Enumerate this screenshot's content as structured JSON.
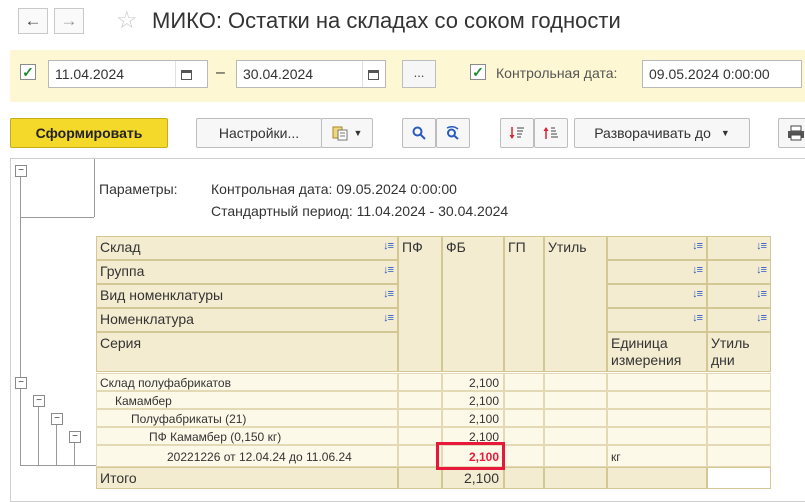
{
  "window": {
    "title": "МИКО: Остатки на складах со соком годности"
  },
  "nav": {
    "back_icon": "←",
    "forward_icon": "→",
    "star_icon": "☆"
  },
  "period": {
    "start_date": "11.04.2024",
    "end_date": "30.04.2024",
    "dash": "–",
    "dots_label": "...",
    "control_label": "Контрольная дата:",
    "control_value": "09.05.2024  0:00:00"
  },
  "toolbar": {
    "generate_label": "Сформировать",
    "settings_label": "Настройки...",
    "expand_label": "Разворачивать до"
  },
  "report": {
    "params_label": "Параметры:",
    "param1": "Контрольная дата: 09.05.2024 0:00:00",
    "param2": "Стандартный период: 11.04.2024 - 30.04.2024",
    "headers": {
      "sklad": "Склад",
      "gruppa": "Группа",
      "vid": "Вид номенклатуры",
      "nomenklatura": "Номенклатура",
      "seriya": "Серия",
      "pf": "ПФ",
      "fb": "ФБ",
      "gp": "ГП",
      "util": "Утиль",
      "unit": "Единица измерения",
      "util_days": "Утиль дни"
    },
    "rows": [
      {
        "label": "Склад полуфабрикатов",
        "fb": "2,100",
        "unit": ""
      },
      {
        "label": "Камамбер",
        "fb": "2,100",
        "unit": ""
      },
      {
        "label": "Полуфабрикаты (21)",
        "fb": "2,100",
        "unit": ""
      },
      {
        "label": "ПФ Камамбер (0,150 кг)",
        "fb": "2,100",
        "unit": ""
      },
      {
        "label": "20221226 от 12.04.24 до 11.06.24",
        "fb": "2,100",
        "unit": "кг"
      }
    ],
    "total": {
      "label": "Итого",
      "fb": "2,100"
    }
  },
  "colors": {
    "accent": "#f4d92b",
    "highlight": "#e8173c",
    "header_bg": "#f3ecd0",
    "row_bg": "#fdf9e8"
  }
}
